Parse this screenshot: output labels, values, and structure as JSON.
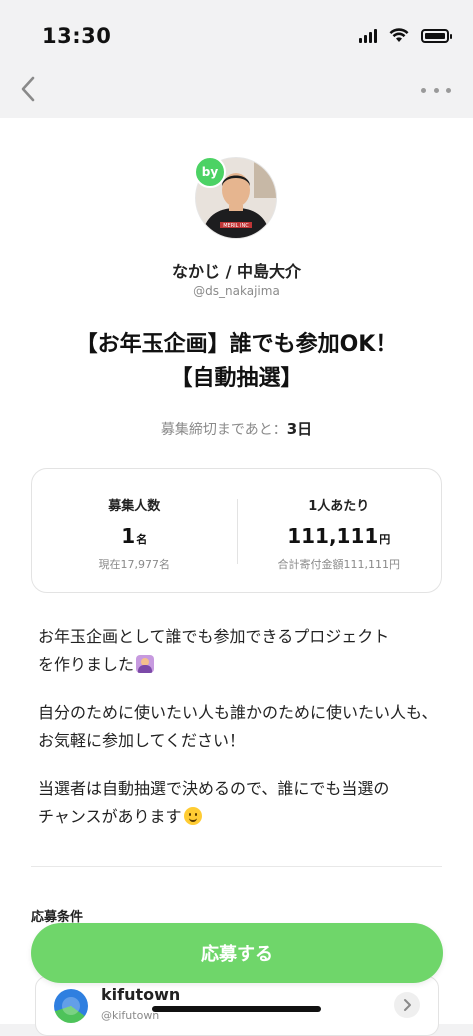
{
  "status_bar": {
    "time": "13:30"
  },
  "nav": {
    "back_icon": "chevron-left-icon",
    "more_icon": "more-horizontal-icon"
  },
  "creator": {
    "badge": "by",
    "name": "なかじ / 中島大介",
    "handle": "@ds_nakajima",
    "shirt_text": "MERIL INC"
  },
  "project": {
    "title_line1": "【お年玉企画】誰でも参加OK！",
    "title_line2": "【自動抽選】",
    "deadline_label": "募集締切まであと：",
    "deadline_value": "3日"
  },
  "stats": {
    "recruit": {
      "label": "募集人数",
      "value": "1",
      "unit": "名",
      "sub": "現在17,977名"
    },
    "per_person": {
      "label": "1人あたり",
      "value": "111,111",
      "unit": "円",
      "sub": "合計寄付金額111,111円"
    }
  },
  "description": {
    "p1_line1": "お年玉企画として誰でも参加できるプロジェクト",
    "p1_line2": "を作りました",
    "p2": "自分のために使いたい人も誰かのために使いたい人も、お気軽に参加してください！",
    "p3_line1": "当選者は自動抽選で決めるので、誰にでも当選の",
    "p3_line2": "チャンスがあります"
  },
  "conditions": {
    "heading": "応募条件"
  },
  "apply_button": {
    "label": "応募する"
  },
  "organization": {
    "name": "kifutown",
    "handle": "@kifutown"
  },
  "colors": {
    "accent": "#6fd66a",
    "badge": "#4cd264",
    "muted": "#8a8a8a"
  }
}
